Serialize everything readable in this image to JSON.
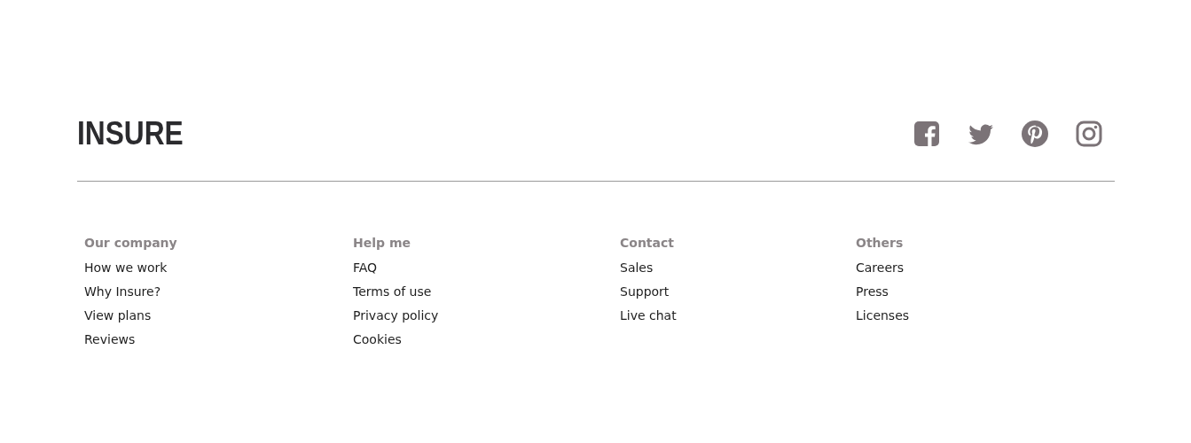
{
  "logo": "INSURE",
  "social_links": [
    {
      "kind": "facebook"
    },
    {
      "kind": "twitter"
    },
    {
      "kind": "pinterest"
    },
    {
      "kind": "instagram"
    }
  ],
  "columns": [
    {
      "heading": "Our company",
      "links": [
        "How we work",
        "Why Insure?",
        "View plans",
        "Reviews"
      ]
    },
    {
      "heading": "Help me",
      "links": [
        "FAQ",
        "Terms of use",
        "Privacy policy",
        "Cookies"
      ]
    },
    {
      "heading": "Contact",
      "links": [
        "Sales",
        "Support",
        "Live chat"
      ]
    },
    {
      "heading": "Others",
      "links": [
        "Careers",
        "Press",
        "Licenses"
      ]
    }
  ]
}
